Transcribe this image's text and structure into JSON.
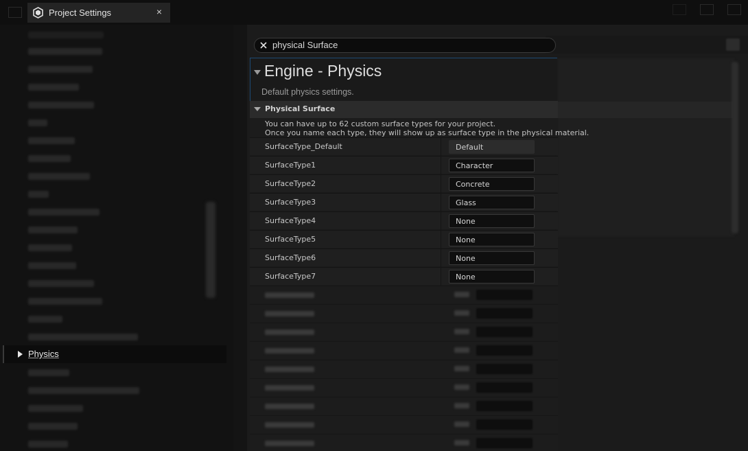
{
  "window": {
    "title": "Project Settings",
    "close_symbol": "×",
    "app_icon": "unreal-settings-icon"
  },
  "sidebar": {
    "selected_item": {
      "label": "Physics",
      "icon": "expand-arrow-icon"
    }
  },
  "search": {
    "value": "physical Surface",
    "clear_icon": "close-icon"
  },
  "section": {
    "title": "Engine - Physics",
    "description": "Default physics settings."
  },
  "category": {
    "label": "Physical Surface",
    "info_line1": "You can have up to 62 custom surface types for your project.",
    "info_line2": "Once you name each type, they will show up as surface type in the physical material."
  },
  "surface_types": [
    {
      "name": "SurfaceType_Default",
      "value": "Default"
    },
    {
      "name": "SurfaceType1",
      "value": "Character"
    },
    {
      "name": "SurfaceType2",
      "value": "Concrete"
    },
    {
      "name": "SurfaceType3",
      "value": "Glass"
    },
    {
      "name": "SurfaceType4",
      "value": "None"
    },
    {
      "name": "SurfaceType5",
      "value": "None"
    },
    {
      "name": "SurfaceType6",
      "value": "None"
    },
    {
      "name": "SurfaceType7",
      "value": "None"
    }
  ],
  "colors": {
    "background": "#141414",
    "panel": "#1f1f1f",
    "accent_border": "#1d4a74",
    "text": "#c8c8c8"
  }
}
